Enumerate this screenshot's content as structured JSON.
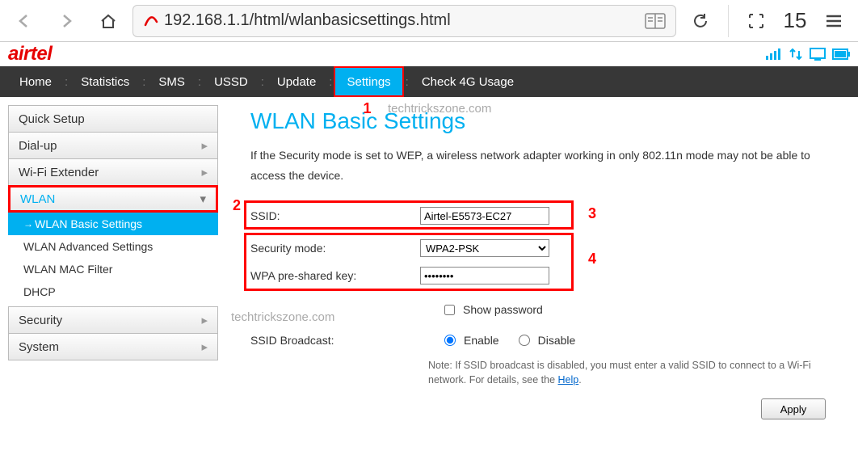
{
  "browser": {
    "url": "192.168.1.1/html/wlanbasicsettings.html",
    "tab_count": "15"
  },
  "brand": "airtel",
  "mainnav": {
    "items": [
      "Home",
      "Statistics",
      "SMS",
      "USSD",
      "Update",
      "Settings",
      "Check 4G Usage"
    ],
    "active_index": 5
  },
  "sidebar": {
    "quick_setup": "Quick Setup",
    "dial_up": "Dial-up",
    "wifi_extender": "Wi-Fi Extender",
    "wlan": "WLAN",
    "wlan_sub": {
      "basic": "WLAN Basic Settings",
      "advanced": "WLAN Advanced Settings",
      "mac": "WLAN MAC Filter",
      "dhcp": "DHCP"
    },
    "security": "Security",
    "system": "System"
  },
  "content": {
    "title": "WLAN Basic Settings",
    "notice": "If the Security mode is set to WEP, a wireless network adapter working in only 802.11n mode may not be able to access the device.",
    "labels": {
      "ssid": "SSID:",
      "security_mode": "Security mode:",
      "wpa_psk": "WPA pre-shared key:",
      "show_password": "Show password",
      "ssid_broadcast": "SSID Broadcast:",
      "enable": "Enable",
      "disable": "Disable"
    },
    "values": {
      "ssid": "Airtel-E5573-EC27",
      "security_mode": "WPA2-PSK",
      "wpa_psk": "••••••••",
      "ssid_broadcast": "enable"
    },
    "footnote_prefix": "Note: If SSID broadcast is disabled, you must enter a valid SSID to connect to a Wi-Fi network. For details, see the ",
    "footnote_link": "Help",
    "footnote_suffix": ".",
    "apply": "Apply"
  },
  "watermark": "techtrickszone.com",
  "annotations": {
    "1": "1",
    "2": "2",
    "3": "3",
    "4": "4"
  }
}
